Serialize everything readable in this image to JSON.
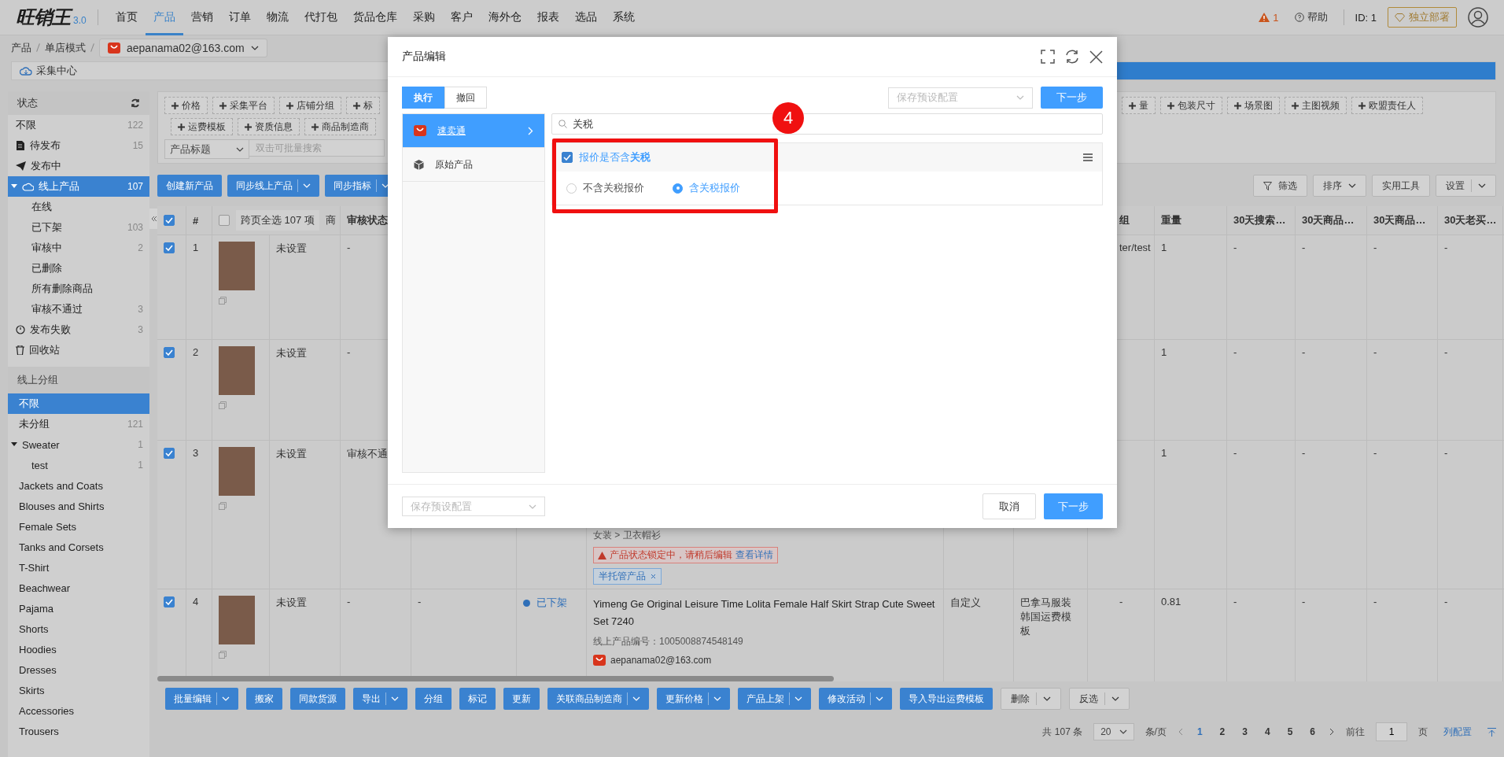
{
  "top_nav": {
    "logo": "旺销王",
    "version": "3.0",
    "items": [
      {
        "label": "首页",
        "selected": false
      },
      {
        "label": "产品",
        "selected": true
      },
      {
        "label": "营销",
        "selected": false
      },
      {
        "label": "订单",
        "selected": false
      },
      {
        "label": "物流",
        "selected": false
      },
      {
        "label": "代打包",
        "selected": false
      },
      {
        "label": "货品仓库",
        "selected": false
      },
      {
        "label": "采购",
        "selected": false
      },
      {
        "label": "客户",
        "selected": false
      },
      {
        "label": "海外仓",
        "selected": false
      },
      {
        "label": "报表",
        "selected": false
      },
      {
        "label": "选品",
        "selected": false
      },
      {
        "label": "系统",
        "selected": false
      }
    ],
    "alert_count": "1",
    "help": "帮助",
    "id_label": "ID: 1",
    "deploy_button": "独立部署"
  },
  "breadcrumb": {
    "items": [
      "产品",
      "单店模式"
    ],
    "store": "aepanama02@163.com"
  },
  "collect_bar": {
    "label": "采集中心"
  },
  "sidebar": {
    "status_title": "状态",
    "status_items": [
      {
        "label": "不限",
        "count": "122",
        "kind": "plain",
        "selected": false
      },
      {
        "label": "待发布",
        "count": "15",
        "kind": "draft",
        "selected": false
      },
      {
        "label": "发布中",
        "kind": "publishing",
        "selected": false
      },
      {
        "label": "线上产品",
        "count": "107",
        "kind": "online",
        "selected": true,
        "expanded": true,
        "children": [
          {
            "label": "在线",
            "selected": false
          },
          {
            "label": "已下架",
            "count": "103",
            "selected": false
          },
          {
            "label": "审核中",
            "count": "2",
            "selected": false
          },
          {
            "label": "已删除",
            "selected": false
          },
          {
            "label": "所有删除商品",
            "selected": false
          },
          {
            "label": "审核不通过",
            "count": "3",
            "selected": false
          }
        ]
      },
      {
        "label": "发布失败",
        "count": "3",
        "kind": "failed",
        "selected": false
      },
      {
        "label": "回收站",
        "kind": "trash",
        "selected": false
      }
    ],
    "group_title": "线上分组",
    "group_items": [
      {
        "label": "不限",
        "selected": true
      },
      {
        "label": "未分组",
        "count": "121",
        "selected": false
      },
      {
        "label": "Sweater",
        "count": "1",
        "selected": false,
        "expanded": true,
        "children": [
          {
            "label": "test",
            "count": "1",
            "selected": false
          }
        ]
      },
      {
        "label": "Jackets and Coats",
        "selected": false
      },
      {
        "label": "Blouses and Shirts",
        "selected": false
      },
      {
        "label": "Female Sets",
        "selected": false
      },
      {
        "label": "Tanks and Corsets",
        "selected": false
      },
      {
        "label": "T-Shirt",
        "selected": false
      },
      {
        "label": "Beachwear",
        "selected": false
      },
      {
        "label": "Pajama",
        "selected": false
      },
      {
        "label": "Shorts",
        "selected": false
      },
      {
        "label": "Hoodies",
        "selected": false
      },
      {
        "label": "Dresses",
        "selected": false
      },
      {
        "label": "Skirts",
        "selected": false
      },
      {
        "label": "Accessories",
        "selected": false
      },
      {
        "label": "Trousers",
        "selected": false
      }
    ]
  },
  "filter_tags": {
    "row_1_left": [
      "价格",
      "采集平台",
      "店铺分组",
      "标"
    ],
    "row_1_right": [
      "量",
      "包装尺寸",
      "场景图",
      "主图视频",
      "欧盟责任人"
    ],
    "row_2": [
      "运费模板",
      "资质信息",
      "商品制造商"
    ]
  },
  "search": {
    "field": "产品标题",
    "placeholder": "双击可批量搜索"
  },
  "toolbar": {
    "left_buttons": [
      {
        "label": "创建新产品",
        "kind": "plain"
      },
      {
        "label": "同步线上产品",
        "kind": "split"
      },
      {
        "label": "同步指标",
        "kind": "split"
      }
    ],
    "right_buttons": [
      {
        "label": "筛选",
        "kind": "filter"
      },
      {
        "label": "排序",
        "kind": "sort"
      },
      {
        "label": "实用工具",
        "kind": "plain"
      },
      {
        "label": "设置",
        "kind": "split"
      }
    ]
  },
  "table": {
    "select_all_checked": true,
    "number_header": "#",
    "cross_page_select": {
      "label": "跨页全选 107 项",
      "checked": false
    },
    "column_4": "商",
    "review_header": "审核状态",
    "group_header": "组",
    "weight_header": "重量",
    "metric_headers": [
      "30天搜索…",
      "30天商品…",
      "30天商品…",
      "30天老买…"
    ],
    "rows": [
      {
        "checked": true,
        "number": "1",
        "column_4": "未设置",
        "review": "-",
        "group": "ter/test",
        "weight": "1",
        "metrics": [
          "-",
          "-",
          "-",
          "-"
        ]
      },
      {
        "checked": true,
        "number": "2",
        "column_4": "未设置",
        "review": "-",
        "weight": "1",
        "metrics": [
          "-",
          "-",
          "-",
          "-"
        ]
      },
      {
        "checked": true,
        "number": "3",
        "column_4": "未设置",
        "review": "审核不通",
        "category": "女装 > 卫衣帽衫",
        "lock_warning": {
          "text": "产品状态锁定中，请稍后编辑",
          "link": "查看详情"
        },
        "tag": "半托管产品",
        "weight": "1",
        "metrics": [
          "-",
          "-",
          "-",
          "-"
        ]
      },
      {
        "checked": true,
        "number": "4",
        "column_4": "未设置",
        "review": "-",
        "column_6": "-",
        "status": "已下架",
        "title": "Yimeng Ge Original Leisure Time Lolita Female Half Skirt Strap Cute Sweet Set 7240",
        "product_id": "线上产品编号：1005008874548149",
        "store": "aepanama02@163.com",
        "custom": "自定义",
        "template": "巴拿马服装韩国运费模板",
        "group": "-",
        "weight": "0.81",
        "metrics": [
          "-",
          "-",
          "-",
          "-"
        ]
      }
    ]
  },
  "bottom_actions": [
    {
      "label": "批量编辑",
      "kind": "split"
    },
    {
      "label": "搬家",
      "kind": "plain"
    },
    {
      "label": "同款货源",
      "kind": "plain"
    },
    {
      "label": "导出",
      "kind": "split"
    },
    {
      "label": "分组",
      "kind": "plain"
    },
    {
      "label": "标记",
      "kind": "plain"
    },
    {
      "label": "更新",
      "kind": "plain"
    },
    {
      "label": "关联商品制造商",
      "kind": "split"
    },
    {
      "label": "更新价格",
      "kind": "split"
    },
    {
      "label": "产品上架",
      "kind": "split"
    },
    {
      "label": "修改活动",
      "kind": "split"
    },
    {
      "label": "导入导出运费模板",
      "kind": "plain"
    },
    {
      "label": "删除",
      "kind": "light"
    },
    {
      "label": "反选",
      "kind": "light"
    }
  ],
  "pagination": {
    "total": "共 107 条",
    "page_size": "20",
    "per_page": "条/页",
    "pages": [
      {
        "label": "1",
        "selected": true
      },
      {
        "label": "2",
        "selected": false
      },
      {
        "label": "3",
        "selected": false
      },
      {
        "label": "4",
        "selected": false
      },
      {
        "label": "5",
        "selected": false
      },
      {
        "label": "6",
        "selected": false
      }
    ],
    "goto": "前往",
    "goto_value": "1",
    "page_unit": "页",
    "column_config": "列配置"
  },
  "modal": {
    "title": "产品编辑",
    "tabs": [
      {
        "label": "执行",
        "selected": true
      },
      {
        "label": "撤回",
        "selected": false
      }
    ],
    "preset_placeholder": "保存预设配置",
    "next_button": "下一步",
    "platforms": [
      {
        "label": "速卖通",
        "kind": "store",
        "selected": true
      },
      {
        "label": "原始产品",
        "kind": "cube",
        "selected": false
      }
    ],
    "search_value": "关税",
    "option": {
      "label": "报价是否含**关税**",
      "checked": true,
      "choices": [
        {
          "label": "不含关税报价",
          "selected": false
        },
        {
          "label": "含关税报价",
          "selected": true
        }
      ]
    },
    "footer_preset_placeholder": "保存预设配置",
    "cancel_button": "取消",
    "footer_next_button": "下一步"
  },
  "annotation": {
    "step": "4"
  }
}
